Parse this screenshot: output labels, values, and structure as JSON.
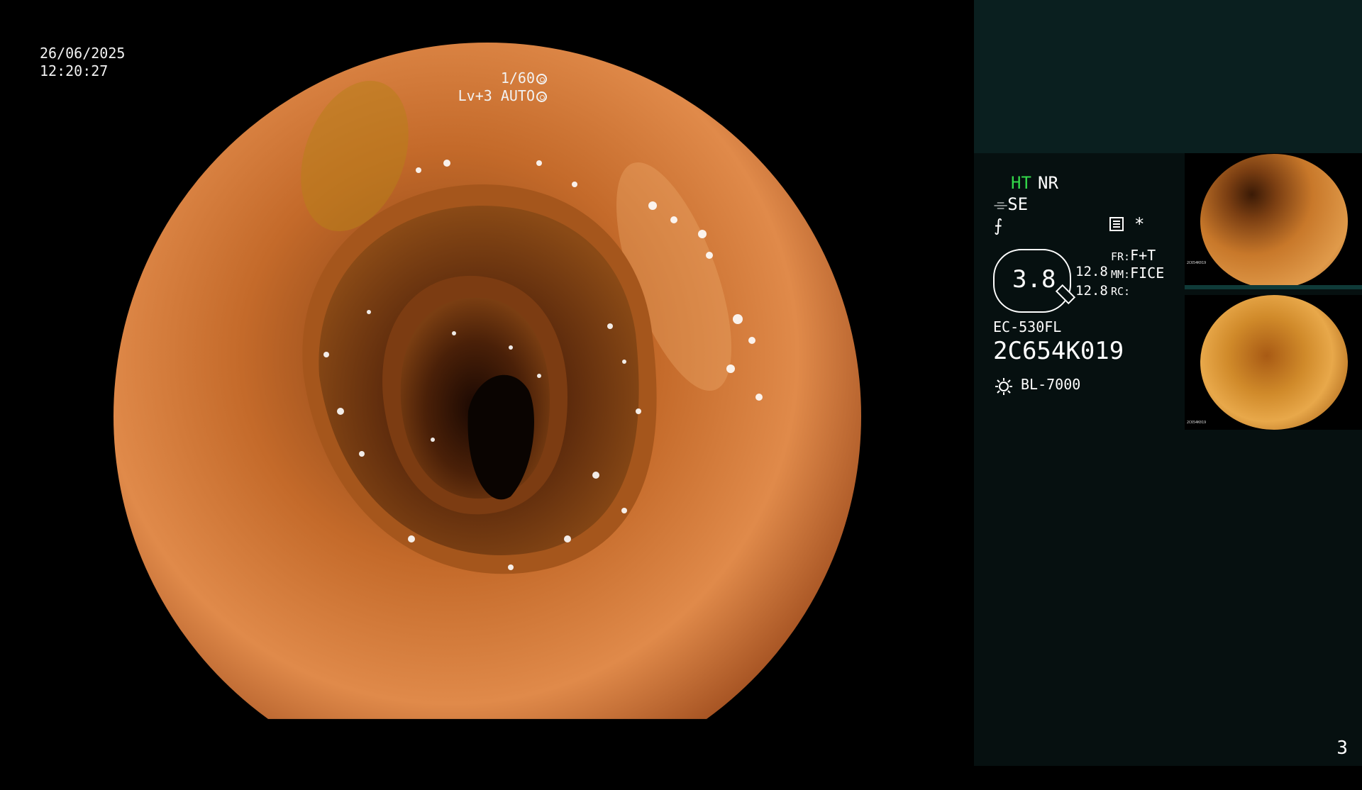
{
  "overlay": {
    "date": "26/06/2025",
    "time": "12:20:27",
    "shutter": "1/60",
    "level": "Lv+3",
    "iris": "AUTO"
  },
  "sidebar": {
    "mode_ht": "HT",
    "mode_nr": "NR",
    "se_label": "SE",
    "asterisk": "*",
    "zoom": "3.8",
    "value_top": "12.8",
    "value_bottom": "12.8",
    "fr_label": "FR:",
    "fr_value": "F+T",
    "mm_label": "MM:",
    "mm_value": "FICE",
    "rc_label": "RC:",
    "scope_model": "EC-530FL",
    "serial": "2C654K019",
    "light_source": "BL-7000",
    "page_number": "3"
  },
  "thumbnails": [
    {
      "index": "2",
      "serial": "2C654K019"
    },
    {
      "index": "1",
      "serial": "2C654K019"
    }
  ],
  "colors": {
    "ht_green": "#33d84a",
    "sidebar_bg": "#061010",
    "sidebar_top_bg": "#0a1f1f"
  }
}
